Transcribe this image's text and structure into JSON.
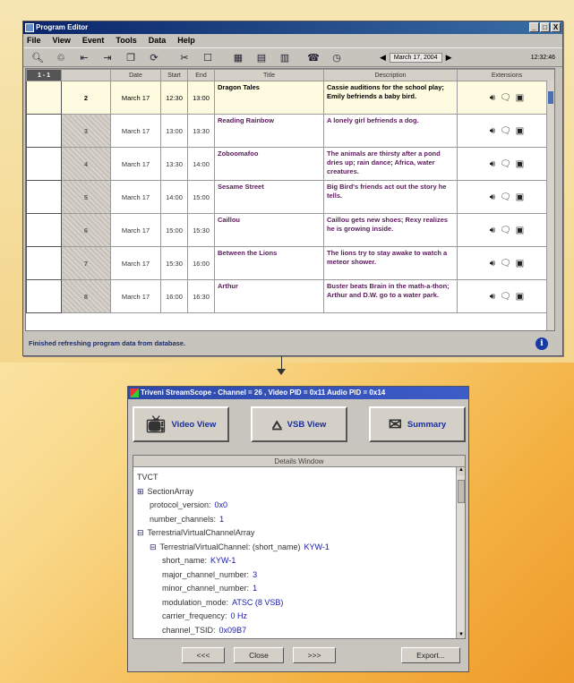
{
  "program_editor": {
    "title": "Program Editor",
    "window_buttons": [
      "_",
      "□",
      "X"
    ],
    "menu": [
      "File",
      "View",
      "Event",
      "Tools",
      "Data",
      "Help"
    ],
    "toolbar": {
      "date": "March 17, 2004",
      "time": "12:32:46",
      "icons": [
        "search-icon",
        "trash-icon",
        "insert-before-icon",
        "insert-after-icon",
        "copy-icon",
        "refresh-icon",
        "link-icon",
        "page-icon",
        "grid-view-icon",
        "list-view-icon",
        "layout-icon",
        "phone-icon",
        "clock-icon"
      ]
    },
    "grid": {
      "corner": "1 - 1",
      "columns": [
        "",
        "Date",
        "Start",
        "End",
        "Title",
        "Description",
        "Extensions"
      ],
      "rows": [
        {
          "num": "2",
          "date": "March 17",
          "start": "12:30",
          "end": "13:00",
          "title": "Dragon Tales",
          "desc": "Cassie auditions for the school play; Emily befriends a baby bird.",
          "selected": true
        },
        {
          "num": "3",
          "date": "March 17",
          "start": "13:00",
          "end": "13:30",
          "title": "Reading Rainbow",
          "desc": "A lonely girl befriends a dog."
        },
        {
          "num": "4",
          "date": "March 17",
          "start": "13:30",
          "end": "14:00",
          "title": "Zoboomafoo",
          "desc": "The animals are thirsty after a pond dries up; rain dance; Africa, water creatures."
        },
        {
          "num": "5",
          "date": "March 17",
          "start": "14:00",
          "end": "15:00",
          "title": "Sesame Street",
          "desc": "Big Bird's friends act out the story he tells."
        },
        {
          "num": "6",
          "date": "March 17",
          "start": "15:00",
          "end": "15:30",
          "title": "Caillou",
          "desc": "Caillou gets new shoes; Rexy realizes he is growing inside."
        },
        {
          "num": "7",
          "date": "March 17",
          "start": "15:30",
          "end": "16:00",
          "title": "Between the Lions",
          "desc": "The lions try to stay awake to watch a meteor shower."
        },
        {
          "num": "8",
          "date": "March 17",
          "start": "16:00",
          "end": "16:30",
          "title": "Arthur",
          "desc": "Buster beats Brain in the math-a-thon; Arthur and D.W. go to a water park."
        }
      ]
    },
    "status": "Finished refreshing program data from database."
  },
  "streamscope": {
    "title": "Triveni StreamScope - Channel = 26 , Video PID = 0x11 Audio PID = 0x14",
    "buttons": {
      "video": "Video View",
      "vsb": "VSB View",
      "summary": "Summary"
    },
    "details_header": "Details Window",
    "tree": [
      {
        "indent": 0,
        "marker": "",
        "key": "TVCT",
        "value": ""
      },
      {
        "indent": 0,
        "marker": "⊞",
        "key": "SectionArray",
        "value": ""
      },
      {
        "indent": 1,
        "marker": "",
        "key": "protocol_version:",
        "value": "0x0"
      },
      {
        "indent": 1,
        "marker": "",
        "key": "number_channels:",
        "value": "1"
      },
      {
        "indent": 0,
        "marker": "⊟",
        "key": "TerrestrialVirtualChannelArray",
        "value": ""
      },
      {
        "indent": 1,
        "marker": "⊟",
        "key": "TerrestrialVirtualChannel: (short_name)",
        "value": "KYW-1"
      },
      {
        "indent": 2,
        "marker": "",
        "key": "short_name:",
        "value": "KYW-1"
      },
      {
        "indent": 2,
        "marker": "",
        "key": "major_channel_number:",
        "value": "3"
      },
      {
        "indent": 2,
        "marker": "",
        "key": "minor_channel_number:",
        "value": "1"
      },
      {
        "indent": 2,
        "marker": "",
        "key": "modulation_mode:",
        "value": "ATSC (8 VSB)"
      },
      {
        "indent": 2,
        "marker": "",
        "key": "carrier_frequency:",
        "value": "0 Hz"
      },
      {
        "indent": 2,
        "marker": "",
        "key": "channel_TSID:",
        "value": "0x09B7"
      }
    ],
    "footer": {
      "prev": "<<<",
      "close": "Close",
      "next": ">>>",
      "export": "Export..."
    }
  }
}
